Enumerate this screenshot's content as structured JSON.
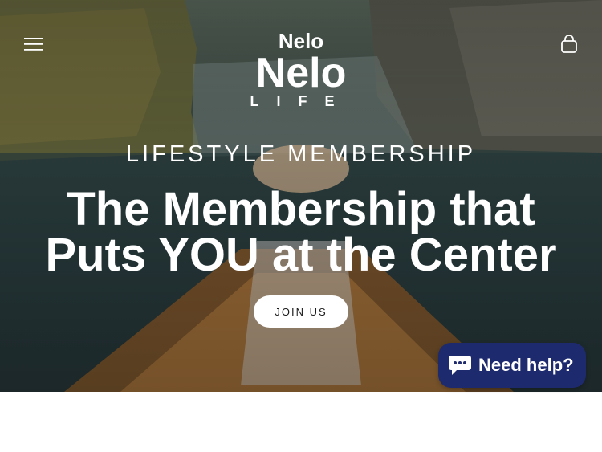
{
  "header": {
    "menu_icon": "hamburger-menu-icon",
    "cart_icon": "shopping-bag-icon",
    "logo": {
      "name": "Nelo",
      "subtitle": "LIFE"
    }
  },
  "hero": {
    "eyebrow": "LIFESTYLE MEMBERSHIP",
    "headline_line1": "The Membership that",
    "headline_line2": "Puts YOU at the Center",
    "cta_label": "JOIN US"
  },
  "chat_widget": {
    "label": "Need help?",
    "icon": "chat-bubble-icon",
    "color": "#1e2a6e"
  }
}
